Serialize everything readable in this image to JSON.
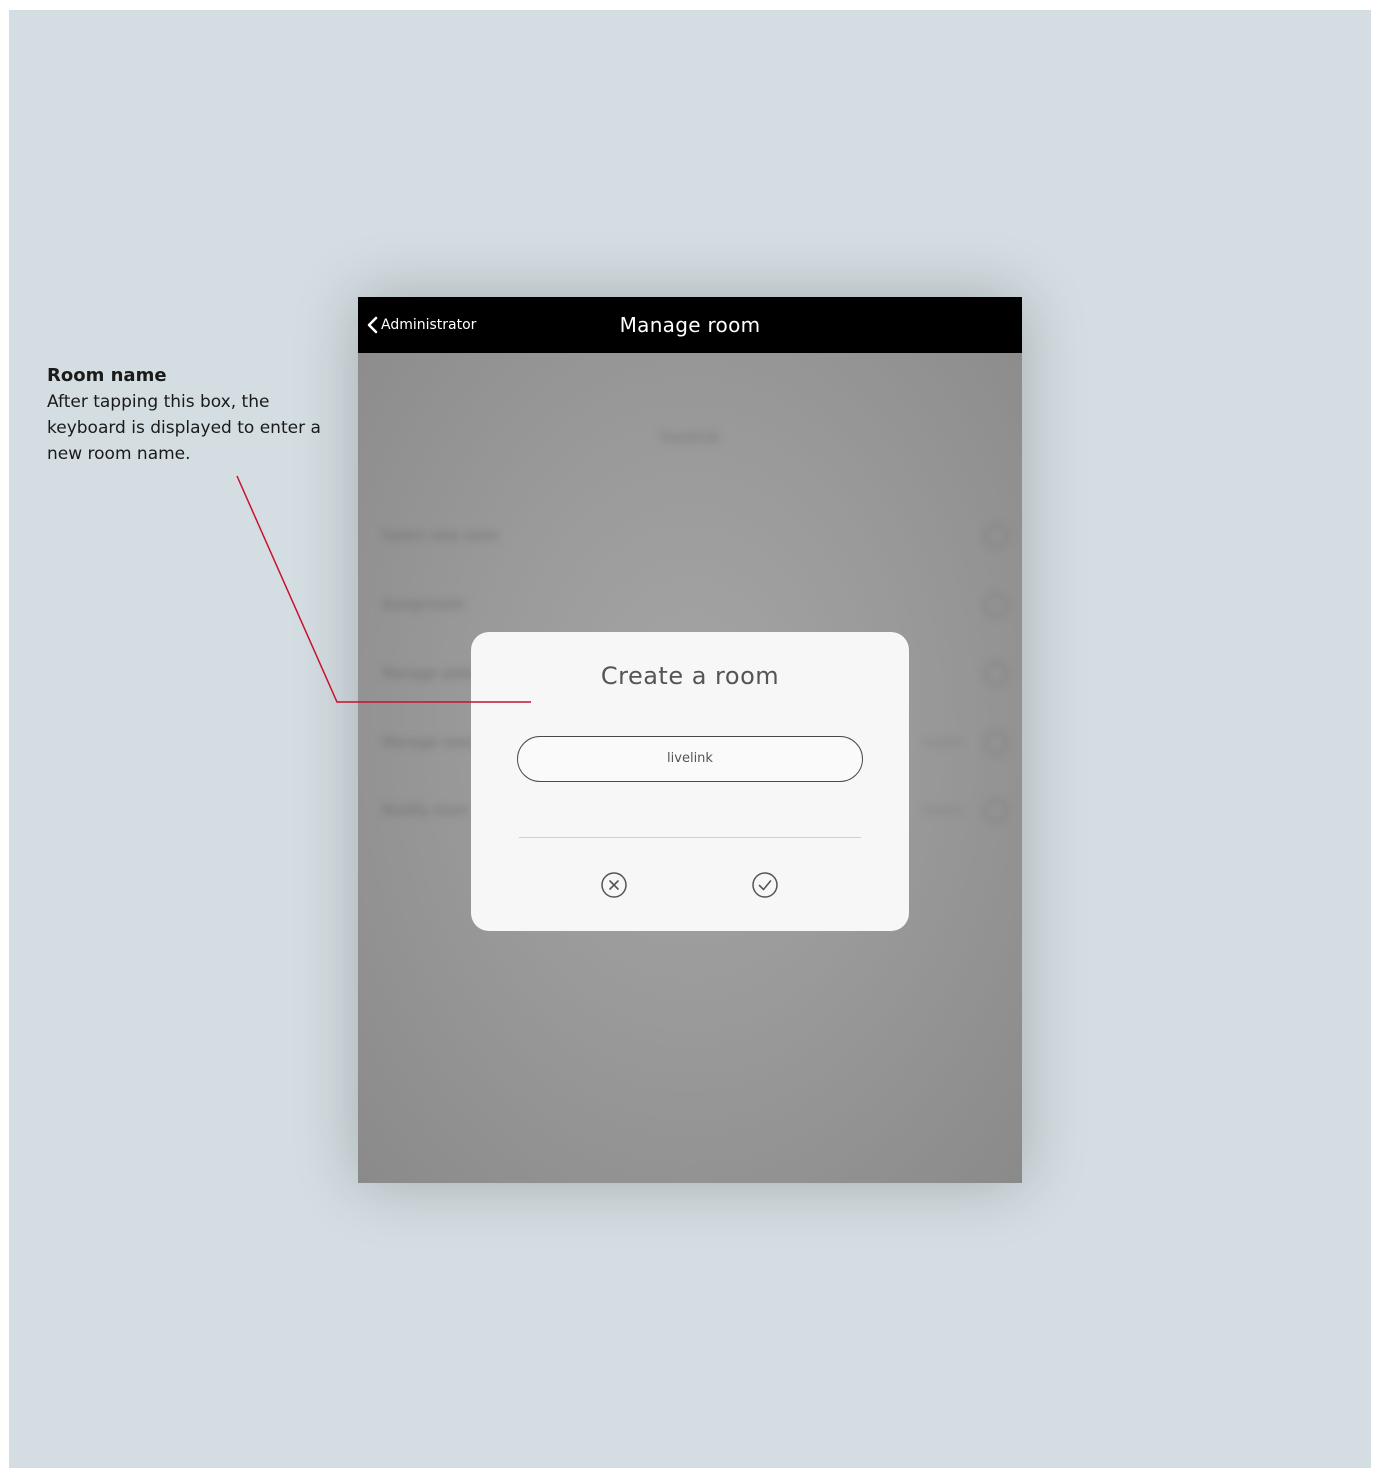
{
  "annotation": {
    "title": "Room name",
    "description": "After tapping this box, the keyboard is displayed to enter a new room name."
  },
  "navbar": {
    "back_label": "Administrator",
    "title": "Manage room"
  },
  "background": {
    "header": "livelink",
    "rows": [
      {
        "label": "Select new room",
        "value": ""
      },
      {
        "label": "Assignment",
        "value": ""
      },
      {
        "label": "Manage address",
        "value": ""
      },
      {
        "label": "Manage room",
        "value": "livelink"
      },
      {
        "label": "Modify room",
        "value": "livelink"
      }
    ]
  },
  "dialog": {
    "title": "Create a room",
    "input_value": "livelink",
    "cancel_icon": "cancel-circle-icon",
    "confirm_icon": "check-circle-icon"
  },
  "colors": {
    "accent_line": "#c8102e",
    "navbar": "#000000",
    "canvas": "#d4dde2"
  }
}
